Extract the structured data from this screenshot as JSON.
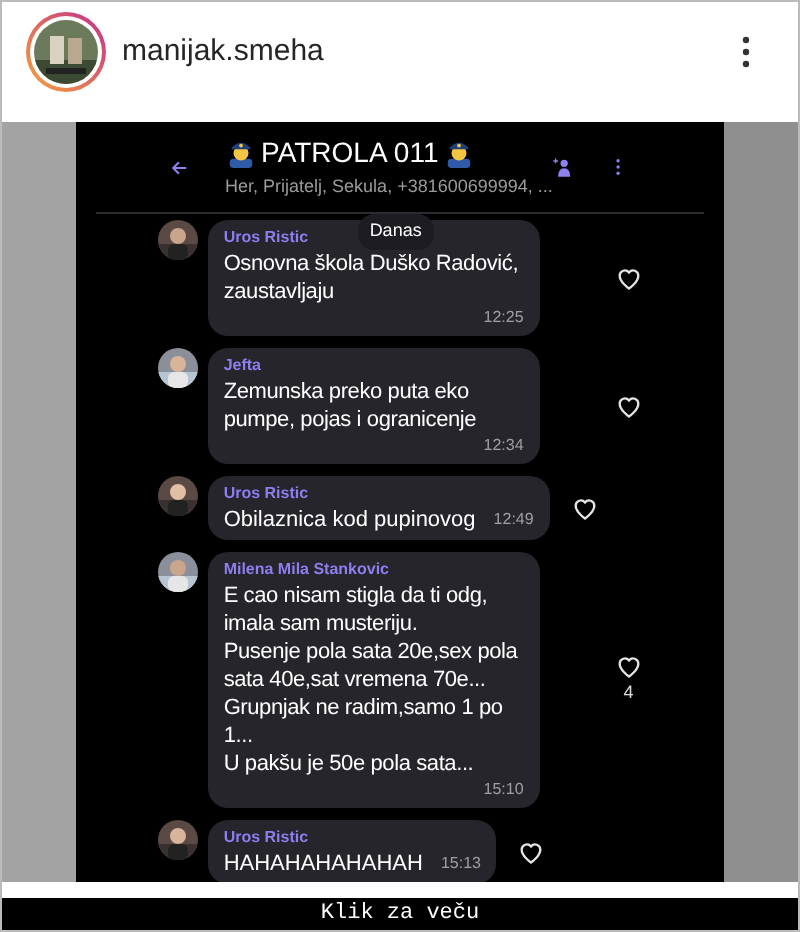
{
  "post": {
    "username": "manijak.smeha"
  },
  "chat": {
    "title": "PATROLA 011",
    "subtitle": "Her, Prijatelj, Sekula, +381600699994, ...",
    "date_separator": "Danas",
    "messages": [
      {
        "kind": "block",
        "sender": "Uros Ristic",
        "text": "Osnovna škola Duško Radović, zaustavljaju",
        "time": "12:25"
      },
      {
        "kind": "block",
        "sender": "Jefta",
        "text": "Zemunska preko puta eko pumpe, pojas i ogranicenje",
        "time": "12:34"
      },
      {
        "kind": "inline",
        "sender": "Uros Ristic",
        "text": "Obilaznica kod pupinovog",
        "time": "12:49"
      },
      {
        "kind": "block",
        "sender": "Milena Mila Stankovic",
        "text": "E cao nisam stigla da ti odg, imala sam musteriju.\nPusenje pola sata 20e,sex pola sata 40e,sat vremena 70e...\nGrupnjak ne radim,samo 1 po 1...\nU pakšu je 50e pola sata...",
        "time": "15:10",
        "likes": "4"
      },
      {
        "kind": "inline",
        "sender": "Uros Ristic",
        "text": "HAHAHAHAHAHAH",
        "time": "15:13"
      }
    ]
  },
  "caption": "Klik za veču"
}
